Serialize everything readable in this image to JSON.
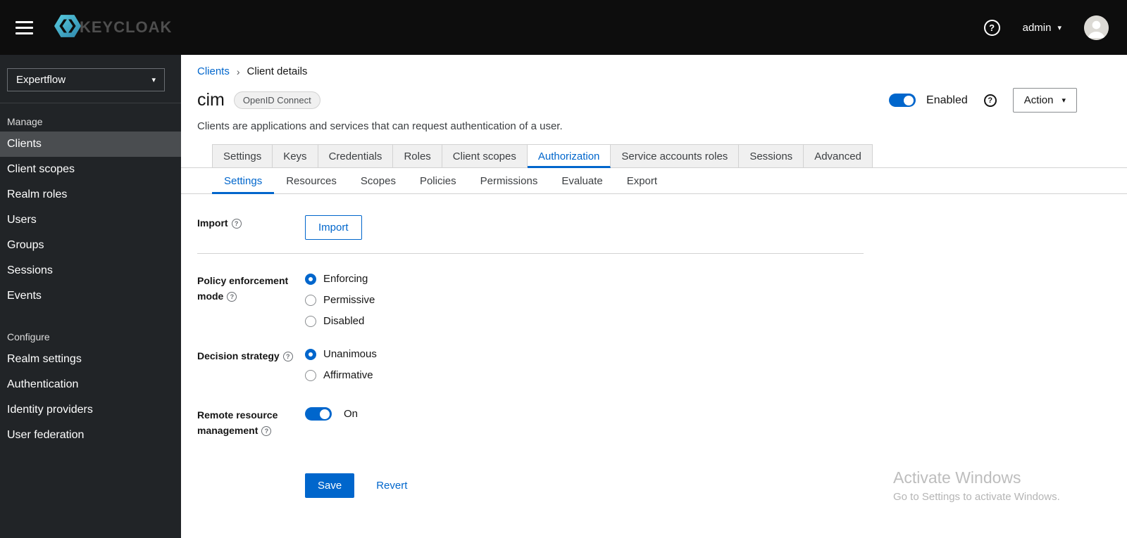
{
  "topbar": {
    "brand": "KEYCLOAK",
    "user": "admin"
  },
  "icons": {
    "help": "?",
    "caret_down": "▾",
    "breadcrumb_sep": "›"
  },
  "sidebar": {
    "realm": "Expertflow",
    "active_item": "Clients",
    "sections": [
      {
        "label": "Manage",
        "items": [
          "Clients",
          "Client scopes",
          "Realm roles",
          "Users",
          "Groups",
          "Sessions",
          "Events"
        ]
      },
      {
        "label": "Configure",
        "items": [
          "Realm settings",
          "Authentication",
          "Identity providers",
          "User federation"
        ]
      }
    ]
  },
  "breadcrumb": {
    "parent": "Clients",
    "current": "Client details"
  },
  "header": {
    "title": "cim",
    "badge": "OpenID Connect",
    "description": "Clients are applications and services that can request authentication of a user.",
    "enabled_label": "Enabled",
    "enabled_state": "on",
    "action_label": "Action"
  },
  "tabs": {
    "main": [
      "Settings",
      "Keys",
      "Credentials",
      "Roles",
      "Client scopes",
      "Authorization",
      "Service accounts roles",
      "Sessions",
      "Advanced"
    ],
    "main_active": "Authorization",
    "sub": [
      "Settings",
      "Resources",
      "Scopes",
      "Policies",
      "Permissions",
      "Evaluate",
      "Export"
    ],
    "sub_active": "Settings"
  },
  "form": {
    "import_label": "Import",
    "import_button": "Import",
    "policy_enforcement": {
      "label": "Policy enforcement mode",
      "options": [
        "Enforcing",
        "Permissive",
        "Disabled"
      ],
      "selected": "Enforcing"
    },
    "decision_strategy": {
      "label": "Decision strategy",
      "options": [
        "Unanimous",
        "Affirmative"
      ],
      "selected": "Unanimous"
    },
    "remote_resource": {
      "label": "Remote resource management",
      "state": "On",
      "enabled": true
    },
    "save_label": "Save",
    "revert_label": "Revert"
  },
  "watermark": {
    "title": "Activate Windows",
    "subtitle": "Go to Settings to activate Windows."
  },
  "colors": {
    "accent": "#0066cc",
    "topbar_bg": "#0d0d0d",
    "sidebar_bg": "#212427",
    "sidebar_active_bg": "#4a4d50",
    "border": "#d2d2d2",
    "text_dark": "#151515",
    "text_gray": "#6a6e73"
  }
}
